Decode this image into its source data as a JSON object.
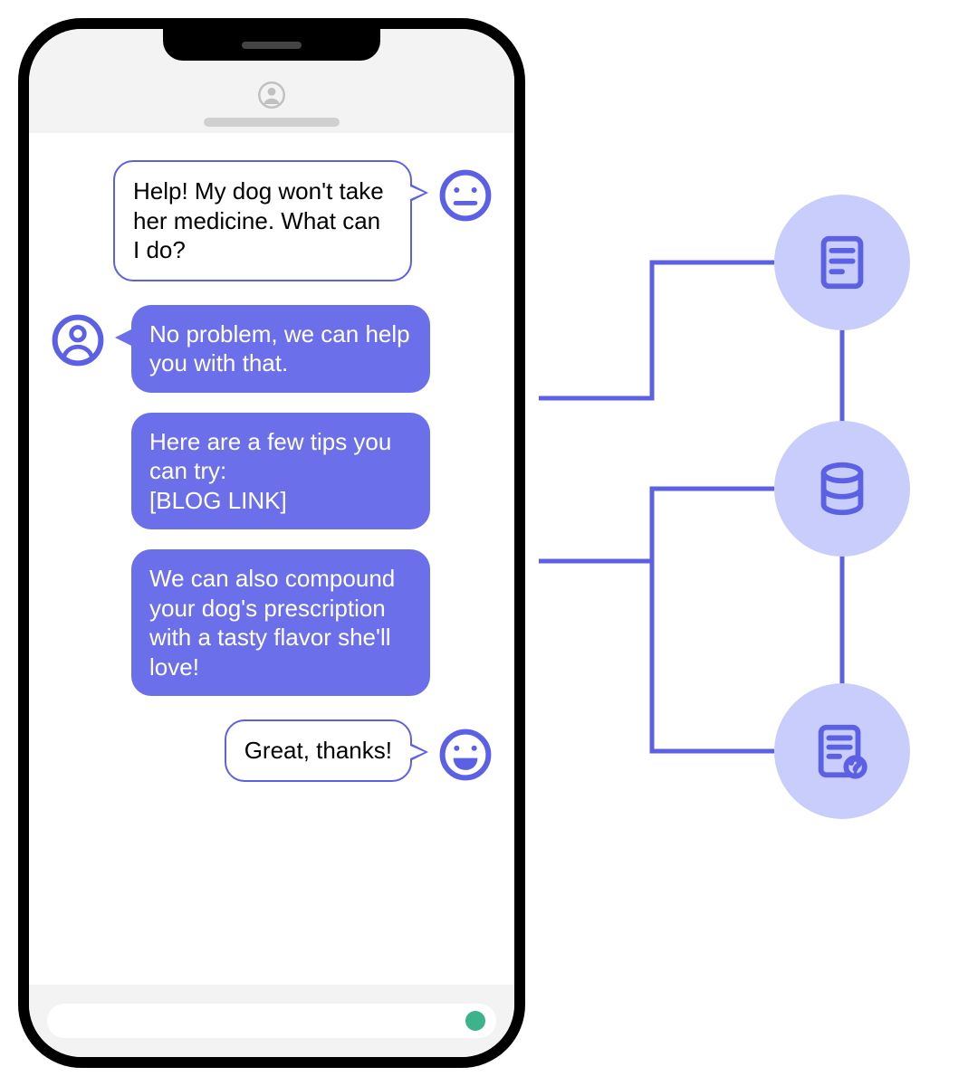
{
  "chat": {
    "messages": [
      {
        "role": "user",
        "text": "Help! My dog won't take her medicine. What can I do?",
        "face": "neutral"
      },
      {
        "role": "agent",
        "text": "No problem, we can help you with that."
      },
      {
        "role": "agent",
        "text": "Here are a few tips you can try:\n[BLOG LINK]"
      },
      {
        "role": "agent",
        "text": "We can also compound your dog's prescription with a tasty flavor she'll love!"
      },
      {
        "role": "user",
        "text": "Great, thanks!",
        "face": "happy"
      }
    ]
  },
  "resources": [
    {
      "icon": "document-icon"
    },
    {
      "icon": "database-icon"
    },
    {
      "icon": "faq-icon"
    }
  ]
}
